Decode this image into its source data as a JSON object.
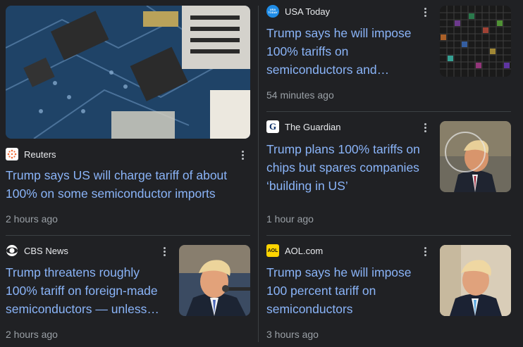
{
  "articles": [
    {
      "source": "Reuters",
      "headline": "Trump says US will charge tariff of about 100% on some semiconductor imports",
      "time": "2 hours ago"
    },
    {
      "source": "CBS News",
      "headline": "Trump threatens roughly 100% tariff on foreign-made semiconductors — unless…",
      "time": "2 hours ago"
    },
    {
      "source": "USA Today",
      "headline": "Trump says he will impose 100% tariffs on semiconductors and…",
      "time": "54 minutes ago"
    },
    {
      "source": "The Guardian",
      "headline": "Trump plans 100% tariffs on chips but spares companies ‘building in US’",
      "time": "1 hour ago"
    },
    {
      "source": "AOL.com",
      "headline": "Trump says he will impose 100 percent tariff on semiconductors",
      "time": "3 hours ago"
    }
  ],
  "logos": {
    "usa_today": "USA TODAY",
    "cbs": "CBS",
    "guardian": "G",
    "aol": "AOL"
  },
  "colors": {
    "background": "#202124",
    "headline": "#8ab4f8",
    "meta": "#9aa0a6"
  }
}
